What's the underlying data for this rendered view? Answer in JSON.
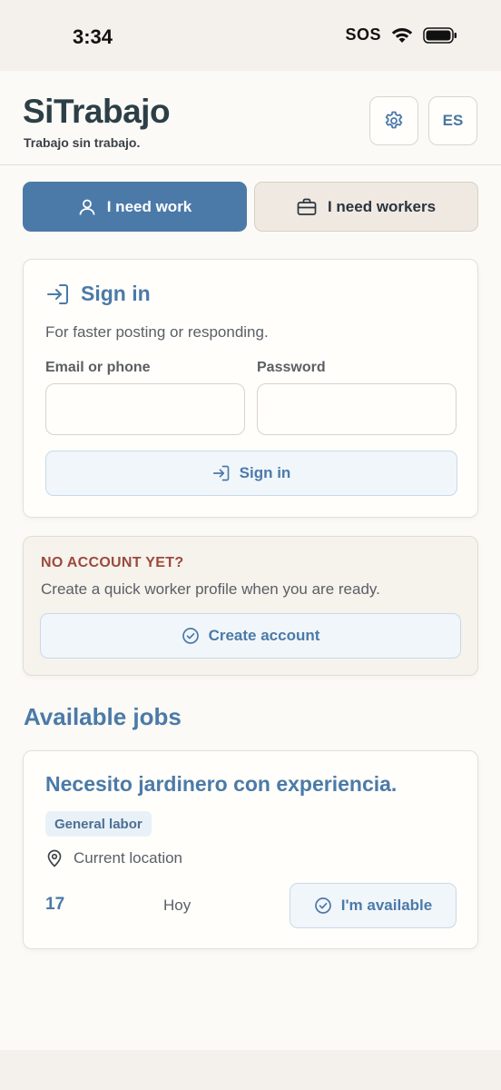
{
  "status_bar": {
    "time": "3:34",
    "sos": "SOS"
  },
  "header": {
    "brand": "SiTrabajo",
    "tagline": "Trabajo sin trabajo.",
    "settings_icon": "gear-icon",
    "language": "ES"
  },
  "roles": {
    "work_label": "I need work",
    "workers_label": "I need workers",
    "selected": "I need work"
  },
  "signin": {
    "title": "Sign in",
    "subtitle": "For faster posting or responding.",
    "email_label": "Email or phone",
    "email_value": "",
    "password_label": "Password",
    "password_value": "",
    "button_label": "Sign in"
  },
  "no_account": {
    "title": "NO ACCOUNT YET?",
    "subtitle": "Create a quick worker profile when you are ready.",
    "button_label": "Create account"
  },
  "jobs": {
    "section_title": "Available jobs",
    "items": [
      {
        "title": "Necesito jardinero con experiencia.",
        "category": "General labor",
        "location": "Current location",
        "count": "17",
        "date": "Hoy",
        "action_label": "I'm available"
      }
    ]
  },
  "colors": {
    "accent": "#4b7aa8",
    "brand_text": "#2c3f47",
    "warning_title": "#9b4a3c",
    "page_bg": "#fbfaf6"
  }
}
